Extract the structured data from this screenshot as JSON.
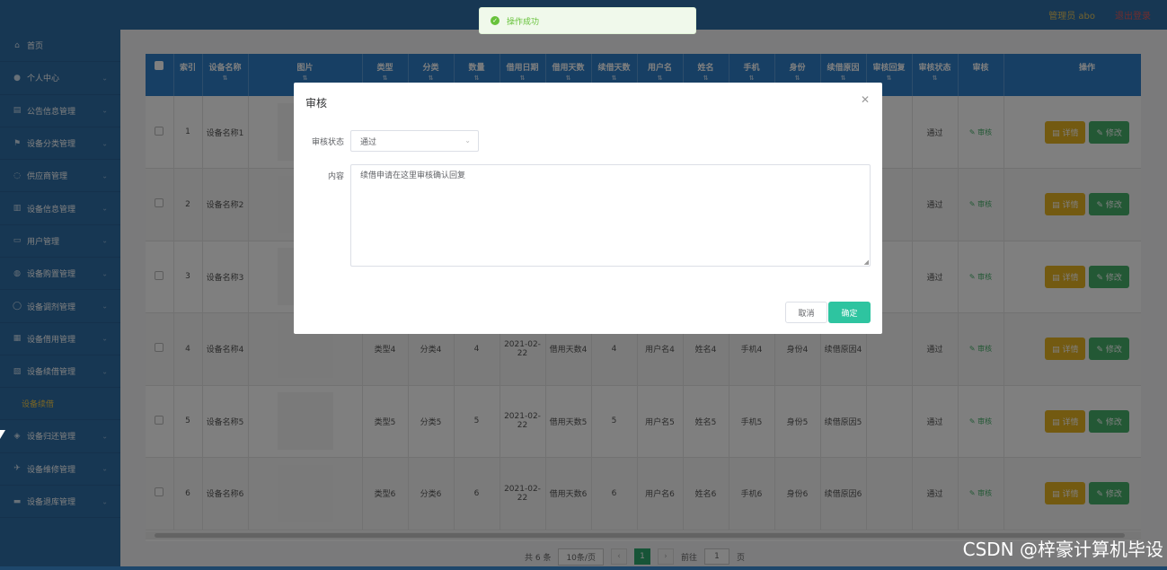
{
  "header": {
    "user_label": "管理员 abo",
    "logout_label": "退出登录"
  },
  "sidebar": {
    "items": [
      {
        "label": "首页",
        "icon": "home-icon"
      },
      {
        "label": "个人中心",
        "icon": "user-icon"
      },
      {
        "label": "公告信息管理",
        "icon": "notice-icon"
      },
      {
        "label": "设备分类管理",
        "icon": "flag-icon"
      },
      {
        "label": "供应商管理",
        "icon": "supplier-icon"
      },
      {
        "label": "设备信息管理",
        "icon": "chart-icon"
      },
      {
        "label": "用户管理",
        "icon": "users-icon"
      },
      {
        "label": "设备购置管理",
        "icon": "purchase-icon"
      },
      {
        "label": "设备调剂管理",
        "icon": "adjust-icon"
      },
      {
        "label": "设备借用管理",
        "icon": "borrow-icon"
      },
      {
        "label": "设备续借管理",
        "icon": "renew-icon"
      }
    ],
    "active_sub": "设备续借",
    "items_after": [
      {
        "label": "设备归还管理",
        "icon": "return-icon"
      },
      {
        "label": "设备维修管理",
        "icon": "repair-icon"
      },
      {
        "label": "设备退库管理",
        "icon": "retire-icon"
      }
    ]
  },
  "table": {
    "headers": [
      "索引",
      "设备名称",
      "图片",
      "类型",
      "分类",
      "数量",
      "借用日期",
      "借用天数",
      "续借天数",
      "用户名",
      "姓名",
      "手机",
      "身份",
      "续借原因",
      "审核回复",
      "审核状态",
      "审核",
      "操作"
    ],
    "rows": [
      {
        "index": "1",
        "name": "设备名称1",
        "type": "",
        "category": "",
        "qty": "",
        "date": "",
        "borrow_days": "",
        "renew_days": "",
        "username": "",
        "realname": "",
        "phone": "",
        "identity": "",
        "reason": "",
        "reply": "",
        "status": "通过"
      },
      {
        "index": "2",
        "name": "设备名称2",
        "type": "",
        "category": "",
        "qty": "",
        "date": "",
        "borrow_days": "",
        "renew_days": "",
        "username": "",
        "realname": "",
        "phone": "",
        "identity": "",
        "reason": "",
        "reply": "",
        "status": "通过"
      },
      {
        "index": "3",
        "name": "设备名称3",
        "type": "",
        "category": "",
        "qty": "",
        "date": "",
        "borrow_days": "",
        "renew_days": "",
        "username": "",
        "realname": "",
        "phone": "",
        "identity": "",
        "reason": "",
        "reply": "",
        "status": "通过"
      },
      {
        "index": "4",
        "name": "设备名称4",
        "type": "类型4",
        "category": "分类4",
        "qty": "4",
        "date": "2021-02-22",
        "borrow_days": "借用天数4",
        "renew_days": "4",
        "username": "用户名4",
        "realname": "姓名4",
        "phone": "手机4",
        "identity": "身份4",
        "reason": "续借原因4",
        "reply": "",
        "status": "通过"
      },
      {
        "index": "5",
        "name": "设备名称5",
        "type": "类型5",
        "category": "分类5",
        "qty": "5",
        "date": "2021-02-22",
        "borrow_days": "借用天数5",
        "renew_days": "5",
        "username": "用户名5",
        "realname": "姓名5",
        "phone": "手机5",
        "identity": "身份5",
        "reason": "续借原因5",
        "reply": "",
        "status": "通过"
      },
      {
        "index": "6",
        "name": "设备名称6",
        "type": "类型6",
        "category": "分类6",
        "qty": "6",
        "date": "2021-02-22",
        "borrow_days": "借用天数6",
        "renew_days": "6",
        "username": "用户名6",
        "realname": "姓名6",
        "phone": "手机6",
        "identity": "身份6",
        "reason": "续借原因6",
        "reply": "",
        "status": "通过"
      }
    ],
    "audit_label": "审核",
    "detail_label": "详情",
    "edit_label": "修改"
  },
  "pager": {
    "total": "共 6 条",
    "page_size": "10条/页",
    "current": "1",
    "goto_label": "前往",
    "goto_value": "1",
    "page_unit": "页"
  },
  "modal": {
    "title": "审核",
    "status_label": "审核状态",
    "status_value": "通过",
    "content_label": "内容",
    "content_value": "续借申请在这里审核确认回复",
    "cancel_label": "取消",
    "ok_label": "确定"
  },
  "toast": {
    "message": "操作成功"
  },
  "watermark": "CSDN @梓豪计算机毕设"
}
